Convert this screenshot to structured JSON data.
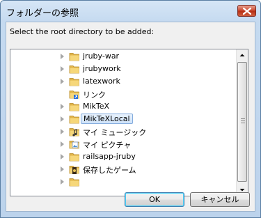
{
  "window": {
    "title": "フォルダーの参照"
  },
  "prompt": "Select the root directory to be added:",
  "tree": {
    "items": [
      {
        "label": "jruby-war",
        "icon": "folder-icon",
        "expandable": true,
        "selected": false
      },
      {
        "label": "jrubywork",
        "icon": "folder-icon",
        "expandable": true,
        "selected": false
      },
      {
        "label": "latexwork",
        "icon": "folder-icon",
        "expandable": true,
        "selected": false
      },
      {
        "label": "リンク",
        "icon": "links-folder-icon",
        "expandable": false,
        "selected": false
      },
      {
        "label": "MikTeX",
        "icon": "folder-icon",
        "expandable": true,
        "selected": false
      },
      {
        "label": "MikTeXLocal",
        "icon": "folder-icon",
        "expandable": true,
        "selected": true
      },
      {
        "label": "マイ ミュージック",
        "icon": "music-folder-icon",
        "expandable": true,
        "selected": false
      },
      {
        "label": "マイ ピクチャ",
        "icon": "pictures-folder-icon",
        "expandable": true,
        "selected": false
      },
      {
        "label": "railsapp-jruby",
        "icon": "folder-icon",
        "expandable": true,
        "selected": false
      },
      {
        "label": "保存したゲーム",
        "icon": "saved-games-folder-icon",
        "expandable": true,
        "selected": false
      },
      {
        "label": "",
        "icon": "folder-icon",
        "expandable": true,
        "selected": false
      }
    ]
  },
  "buttons": {
    "ok": "OK",
    "cancel": "キャンセル"
  }
}
